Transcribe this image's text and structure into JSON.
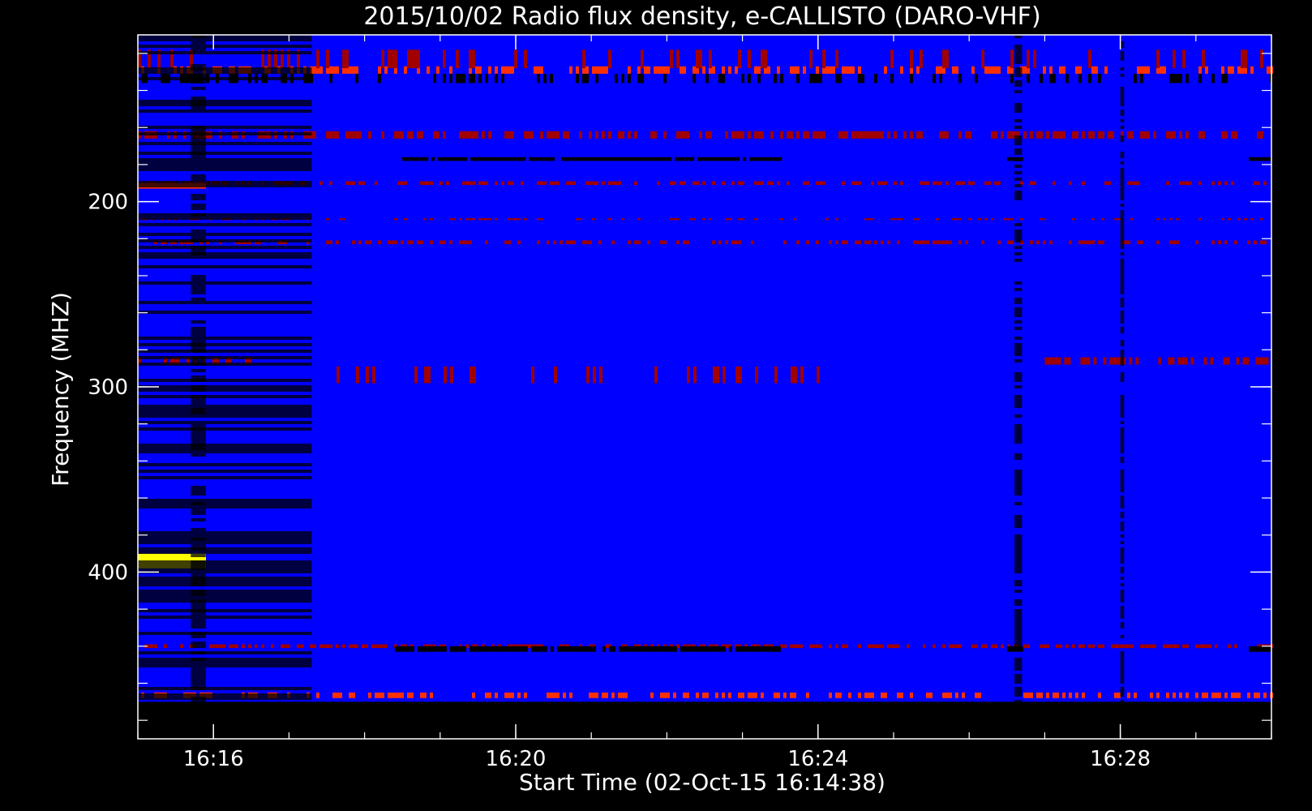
{
  "chart_data": {
    "type": "heatmap",
    "title": "2015/10/02  Radio flux density, e-CALLISTO (DARO-VHF)",
    "xlabel": "Start Time (02-Oct-15 16:14:38)",
    "ylabel": "Frequency (MHZ)",
    "x_ticks": [
      {
        "value": 16.0,
        "label": "16:16"
      },
      {
        "value": 20.0,
        "label": "16:20"
      },
      {
        "value": 24.0,
        "label": "16:24"
      },
      {
        "value": 28.0,
        "label": "16:28"
      }
    ],
    "y_ticks": [
      {
        "value": 200,
        "label": "200"
      },
      {
        "value": 300,
        "label": "300"
      },
      {
        "value": 400,
        "label": "400"
      }
    ],
    "xlim": [
      15.0,
      30.0
    ],
    "ylim": [
      110,
      490
    ],
    "data_extent": {
      "x": [
        15.0,
        30.0
      ],
      "y": [
        110,
        470
      ]
    },
    "y_inverted": true,
    "colors": {
      "background": "#0000ff",
      "low": "#000000",
      "mid": "#a00000",
      "high": "#ff3000",
      "peak": "#ffff00",
      "frame": "#ffffff"
    },
    "features": [
      {
        "kind": "hband",
        "y": [
          127,
          131
        ],
        "x": [
          15.0,
          30.0
        ],
        "color": "#ff3000",
        "density": 0.45
      },
      {
        "kind": "hband",
        "y": [
          131,
          136
        ],
        "x": [
          15.0,
          30.0
        ],
        "color": "#000000",
        "density": 0.3
      },
      {
        "kind": "hband",
        "y": [
          118,
          128
        ],
        "x": [
          15.0,
          30.0
        ],
        "color": "#a00000",
        "density": 0.15
      },
      {
        "kind": "hband",
        "y": [
          162,
          166
        ],
        "x": [
          15.0,
          30.0
        ],
        "color": "#a00000",
        "density": 0.5
      },
      {
        "kind": "hband",
        "y": [
          176,
          178
        ],
        "x": [
          18.5,
          23.5
        ],
        "color": "#000000",
        "density": 0.9
      },
      {
        "kind": "hband",
        "y": [
          176,
          178
        ],
        "x": [
          26.5,
          26.7
        ],
        "color": "#000000",
        "density": 1.0
      },
      {
        "kind": "hband",
        "y": [
          176,
          178
        ],
        "x": [
          29.7,
          30.0
        ],
        "color": "#000000",
        "density": 1.0
      },
      {
        "kind": "hband",
        "y": [
          189,
          191
        ],
        "x": [
          15.0,
          30.0
        ],
        "color": "#a00000",
        "density": 0.45
      },
      {
        "kind": "hband",
        "y": [
          190,
          193
        ],
        "x": [
          15.0,
          15.9
        ],
        "color": "#ff3000",
        "density": 1.0
      },
      {
        "kind": "hband",
        "y": [
          209,
          210
        ],
        "x": [
          15.0,
          30.0
        ],
        "color": "#a00000",
        "density": 0.3
      },
      {
        "kind": "hband",
        "y": [
          221,
          223
        ],
        "x": [
          15.0,
          30.0
        ],
        "color": "#a00000",
        "density": 0.45
      },
      {
        "kind": "hband",
        "y": [
          284,
          288
        ],
        "x": [
          27.0,
          30.0
        ],
        "color": "#a00000",
        "density": 0.55
      },
      {
        "kind": "hband",
        "y": [
          284,
          288
        ],
        "x": [
          15.0,
          16.5
        ],
        "color": "#a00000",
        "density": 0.3
      },
      {
        "kind": "hband",
        "y": [
          289,
          298
        ],
        "x": [
          17.5,
          24.0
        ],
        "color": "#a00000",
        "density": 0.2
      },
      {
        "kind": "hband",
        "y": [
          390,
          398
        ],
        "x": [
          15.0,
          15.9
        ],
        "color": "#ffff00",
        "density": 1.0
      },
      {
        "kind": "hband",
        "y": [
          439,
          441
        ],
        "x": [
          15.0,
          30.0
        ],
        "color": "#a00000",
        "density": 0.55
      },
      {
        "kind": "hband",
        "y": [
          440,
          443
        ],
        "x": [
          18.4,
          23.5
        ],
        "color": "#000000",
        "density": 0.9
      },
      {
        "kind": "hband",
        "y": [
          440,
          443
        ],
        "x": [
          26.5,
          26.7
        ],
        "color": "#000000",
        "density": 1.0
      },
      {
        "kind": "hband",
        "y": [
          440,
          443
        ],
        "x": [
          29.7,
          30.0
        ],
        "color": "#000000",
        "density": 1.0
      },
      {
        "kind": "hband",
        "y": [
          465,
          468
        ],
        "x": [
          15.0,
          30.0
        ],
        "color": "#ff3000",
        "density": 0.45
      },
      {
        "kind": "vband",
        "x": [
          15.0,
          17.3
        ],
        "y": [
          110,
          470
        ],
        "color": "#000000",
        "density": 0.35
      },
      {
        "kind": "vband",
        "x": [
          15.7,
          15.9
        ],
        "y": [
          110,
          470
        ],
        "color": "#000000",
        "density": 0.6
      },
      {
        "kind": "vband",
        "x": [
          26.6,
          26.7
        ],
        "y": [
          110,
          470
        ],
        "color": "#000000",
        "density": 0.55
      },
      {
        "kind": "vband",
        "x": [
          28.0,
          28.05
        ],
        "y": [
          110,
          470
        ],
        "color": "#000000",
        "density": 0.7
      }
    ]
  }
}
